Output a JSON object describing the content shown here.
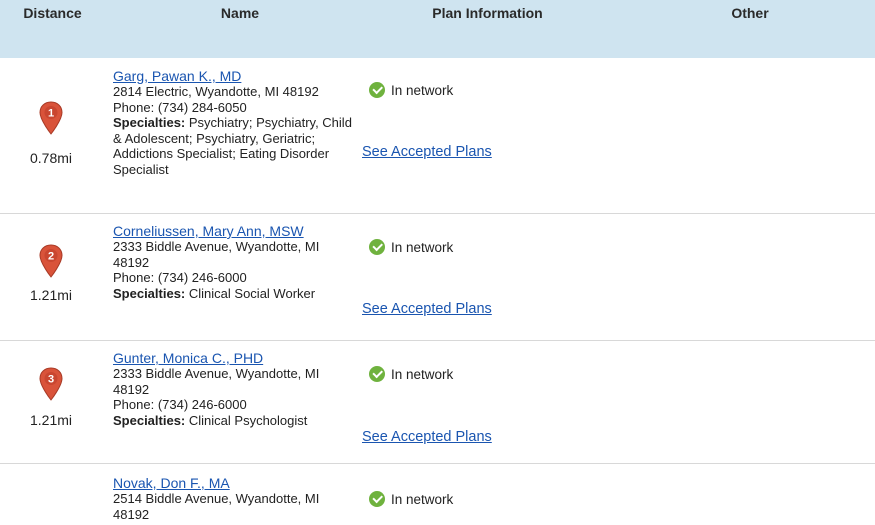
{
  "table": {
    "headers": {
      "distance": "Distance",
      "name": "Name",
      "plan": "Plan Information",
      "other": "Other"
    },
    "rows": [
      {
        "marker": "1",
        "distance": "0.78mi",
        "name": "Garg, Pawan K., MD",
        "address": "2814 Electric, Wyandotte, MI 48192",
        "address2": "",
        "phone": "Phone: (734) 284-6050",
        "specialties_label": "Specialties:",
        "specialties": "Psychiatry; Psychiatry, Child & Adolescent; Psychiatry, Geriatric; Addictions Specialist; Eating Disorder Specialist",
        "network": "In network",
        "plans_link": "See Accepted Plans"
      },
      {
        "marker": "2",
        "distance": "1.21mi",
        "name": "Corneliussen, Mary Ann, MSW",
        "address": "2333 Biddle Avenue, Wyandotte, MI",
        "address2": "48192",
        "phone": "Phone: (734) 246-6000",
        "specialties_label": "Specialties:",
        "specialties": "Clinical Social Worker",
        "network": "In network",
        "plans_link": "See Accepted Plans"
      },
      {
        "marker": "3",
        "distance": "1.21mi",
        "name": "Gunter, Monica C., PHD",
        "address": "2333 Biddle Avenue, Wyandotte, MI",
        "address2": "48192",
        "phone": "Phone: (734) 246-6000",
        "specialties_label": "Specialties:",
        "specialties": "Clinical Psychologist",
        "network": "In network",
        "plans_link": "See Accepted Plans"
      },
      {
        "name": "Novak, Don F., MA",
        "address": "2514 Biddle Avenue, Wyandotte, MI",
        "address2": "48192",
        "network": "In network"
      }
    ]
  },
  "colors": {
    "header_bg": "#cfe4f0",
    "link": "#1a55b0",
    "marker": "#d9533a",
    "check": "#6fb23e"
  },
  "icons": {
    "marker": "map-pin-icon",
    "network": "check-circle-icon"
  }
}
